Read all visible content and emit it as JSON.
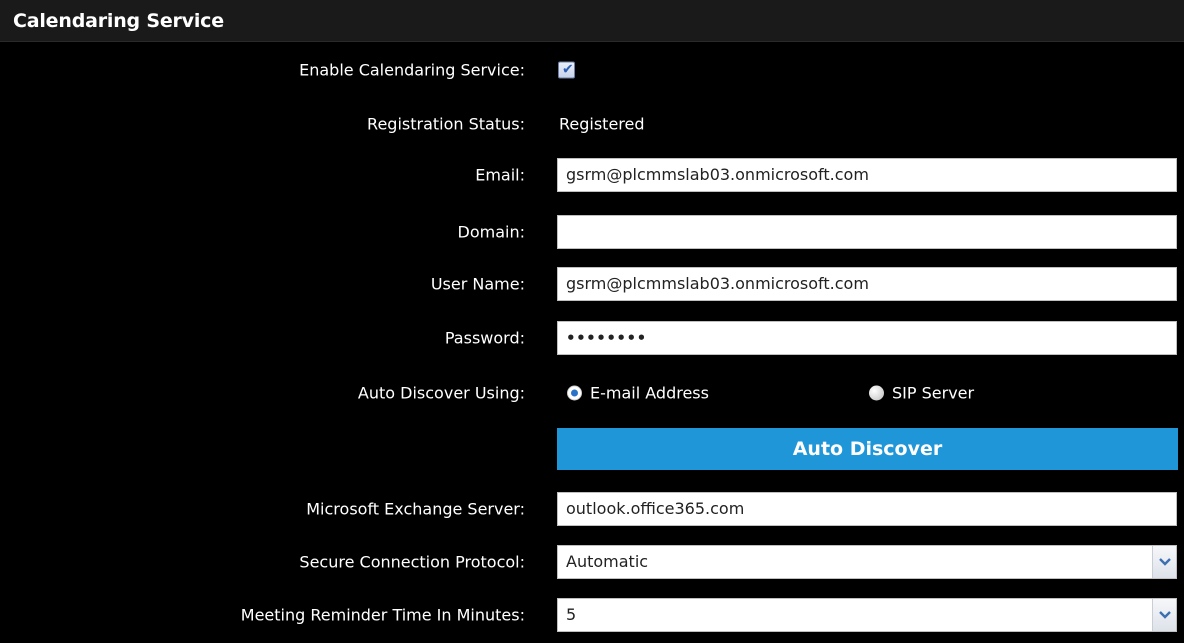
{
  "header": {
    "title": "Calendaring Service"
  },
  "fields": {
    "enable": {
      "label": "Enable Calendaring Service:",
      "checked": true
    },
    "registration": {
      "label": "Registration Status:",
      "value": "Registered"
    },
    "email": {
      "label": "Email:",
      "value": "gsrm@plcmmslab03.onmicrosoft.com"
    },
    "domain": {
      "label": "Domain:",
      "value": ""
    },
    "username": {
      "label": "User Name:",
      "value": "gsrm@plcmmslab03.onmicrosoft.com"
    },
    "password": {
      "label": "Password:",
      "value": "••••••••"
    },
    "autodiscover_using": {
      "label": "Auto Discover Using:",
      "options": [
        "E-mail Address",
        "SIP Server"
      ],
      "selected": "E-mail Address"
    },
    "autodiscover_button": {
      "label": "Auto Discover"
    },
    "exchange_server": {
      "label": "Microsoft Exchange Server:",
      "value": "outlook.office365.com"
    },
    "secure_protocol": {
      "label": "Secure Connection Protocol:",
      "value": "Automatic"
    },
    "reminder": {
      "label": "Meeting Reminder Time In Minutes:",
      "value": "5"
    }
  },
  "colors": {
    "background": "#000000",
    "accent_button": "#1f96d8",
    "radio_selected": "#2a73c6"
  },
  "icons": {
    "checkbox": "check-icon",
    "dropdown": "chevron-down-icon"
  }
}
